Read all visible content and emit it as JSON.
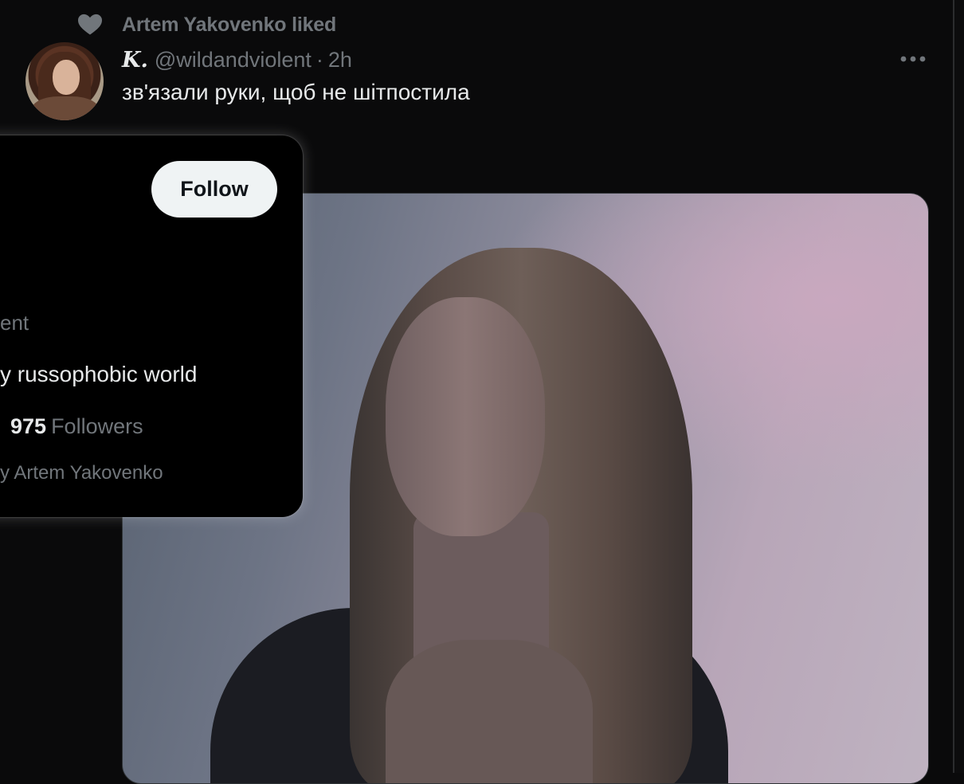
{
  "context": {
    "liked_by_text": "Artem Yakovenko liked",
    "icon": "heart-icon"
  },
  "tweet": {
    "display_name": "K.",
    "handle": "@wildandviolent",
    "separator": "·",
    "time": "2h",
    "text": "зв'язали руки, щоб не шітпостила",
    "more_icon": "more-horizontal-icon"
  },
  "hovercard": {
    "follow_label": "Follow",
    "handle_fragment": "ent",
    "bio_fragment": "y russophobic world",
    "followers_count": "975",
    "followers_label": "Followers",
    "followed_by_fragment": "y Artem Yakovenko"
  },
  "colors": {
    "background": "#0a0a0b",
    "text": "#e7e9ea",
    "secondary": "#71767b",
    "button": "#eff3f4"
  }
}
